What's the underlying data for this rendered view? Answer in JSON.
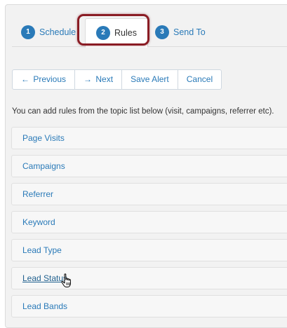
{
  "tabs": [
    {
      "number": "1",
      "label": "Schedule"
    },
    {
      "number": "2",
      "label": "Rules"
    },
    {
      "number": "3",
      "label": "Send To"
    }
  ],
  "buttons": {
    "previous": {
      "arrow": "←",
      "label": "Previous"
    },
    "next": {
      "arrow": "→",
      "label": "Next"
    },
    "save_alert": "Save Alert",
    "cancel": "Cancel"
  },
  "intro_text": "You can add rules from the topic list below (visit, campaigns, referrer etc).",
  "rules": [
    "Page Visits",
    "Campaigns",
    "Referrer",
    "Keyword",
    "Lead Type",
    "Lead Status",
    "Lead Bands"
  ],
  "colors": {
    "link": "#2a7ab8",
    "highlight": "#8a1c24"
  },
  "hovered_rule": "Lead Status",
  "cursor_icon": "hand-pointer-icon"
}
